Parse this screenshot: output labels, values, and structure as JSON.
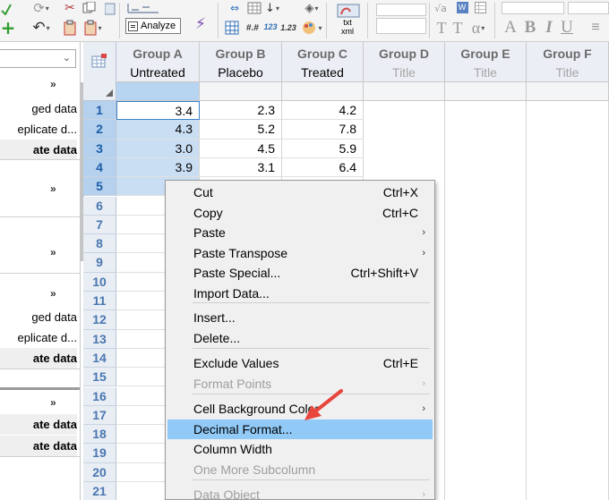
{
  "toolbar": {
    "analyze_label": "Analyze",
    "superscript_label": "123",
    "subscript_label": "1.23",
    "xml_label": "xml",
    "txt_label": "txt",
    "text_glyphs": {
      "t": "T",
      "t2": "T",
      "alpha": "α",
      "a": "A",
      "b": "B",
      "i": "I",
      "u": "U"
    },
    "icons": [
      "undo-icon",
      "redo-icon",
      "cut-icon",
      "copy-icon",
      "paste-icon",
      "new-table-icon",
      "analyze-icon",
      "sort-icon",
      "export-icon",
      "font-color-icon"
    ]
  },
  "navigator": {
    "combo_value": "",
    "sections": [
      {
        "chevron": "»",
        "items": [
          {
            "label": "ged data",
            "bold": false
          },
          {
            "label": "eplicate d...",
            "bold": false
          },
          {
            "label": "ate data",
            "bold": true
          }
        ]
      },
      {
        "chevron": "»",
        "items": []
      },
      {
        "chevron": "»",
        "items": []
      },
      {
        "chevron": "»",
        "items": [
          {
            "label": "ged data",
            "bold": false
          },
          {
            "label": "eplicate d...",
            "bold": false
          },
          {
            "label": "ate data",
            "bold": true
          }
        ]
      },
      {
        "chevron": "»",
        "items": [
          {
            "label": "ate data",
            "bold": true
          },
          {
            "label": "ate data",
            "bold": true
          }
        ]
      }
    ]
  },
  "grid": {
    "columns": [
      {
        "group": "Group A",
        "title": "Untreated",
        "placeholder": false
      },
      {
        "group": "Group B",
        "title": "Placebo",
        "placeholder": false
      },
      {
        "group": "Group C",
        "title": "Treated",
        "placeholder": false
      },
      {
        "group": "Group D",
        "title": "Title",
        "placeholder": true
      },
      {
        "group": "Group E",
        "title": "Title",
        "placeholder": true
      },
      {
        "group": "Group F",
        "title": "Title",
        "placeholder": true
      }
    ],
    "rows": [
      {
        "n": "1",
        "values": [
          "3.4",
          "2.3",
          "4.2"
        ]
      },
      {
        "n": "2",
        "values": [
          "4.3",
          "5.2",
          "7.8"
        ]
      },
      {
        "n": "3",
        "values": [
          "3.0",
          "4.5",
          "5.9"
        ]
      },
      {
        "n": "4",
        "values": [
          "3.9",
          "3.1",
          "6.4"
        ]
      },
      {
        "n": "5",
        "values": [
          "",
          "",
          ""
        ]
      },
      {
        "n": "6",
        "values": [
          "",
          "",
          ""
        ]
      },
      {
        "n": "7",
        "values": [
          "",
          "",
          ""
        ]
      },
      {
        "n": "8",
        "values": [
          "",
          "",
          ""
        ]
      },
      {
        "n": "9",
        "values": [
          "",
          "",
          ""
        ]
      },
      {
        "n": "10",
        "values": [
          "",
          "",
          ""
        ]
      },
      {
        "n": "11",
        "values": [
          "",
          "",
          ""
        ]
      },
      {
        "n": "12",
        "values": [
          "",
          "",
          ""
        ]
      },
      {
        "n": "13",
        "values": [
          "",
          "",
          ""
        ]
      },
      {
        "n": "14",
        "values": [
          "",
          "",
          ""
        ]
      },
      {
        "n": "15",
        "values": [
          "",
          "",
          ""
        ]
      },
      {
        "n": "16",
        "values": [
          "",
          "",
          ""
        ]
      },
      {
        "n": "17",
        "values": [
          "",
          "",
          ""
        ]
      },
      {
        "n": "18",
        "values": [
          "",
          "",
          ""
        ]
      },
      {
        "n": "19",
        "values": [
          "",
          "",
          ""
        ]
      },
      {
        "n": "20",
        "values": [
          "",
          "",
          ""
        ]
      },
      {
        "n": "21",
        "values": [
          "",
          "",
          ""
        ]
      }
    ],
    "selected_rows": [
      "1",
      "2",
      "3",
      "4",
      "5"
    ],
    "selection_color": "#c9def3"
  },
  "context_menu": {
    "items": [
      {
        "label": "Cut",
        "shortcut": "Ctrl+X",
        "submenu": false,
        "disabled": false,
        "highlighted": false
      },
      {
        "label": "Copy",
        "shortcut": "Ctrl+C",
        "submenu": false,
        "disabled": false,
        "highlighted": false
      },
      {
        "label": "Paste",
        "shortcut": "",
        "submenu": true,
        "disabled": false,
        "highlighted": false
      },
      {
        "label": "Paste Transpose",
        "shortcut": "",
        "submenu": true,
        "disabled": false,
        "highlighted": false
      },
      {
        "label": "Paste Special...",
        "shortcut": "Ctrl+Shift+V",
        "submenu": false,
        "disabled": false,
        "highlighted": false
      },
      {
        "label": "Import Data...",
        "shortcut": "",
        "submenu": false,
        "disabled": false,
        "highlighted": false
      },
      {
        "label": "Insert...",
        "shortcut": "",
        "submenu": false,
        "disabled": false,
        "highlighted": false
      },
      {
        "label": "Delete...",
        "shortcut": "",
        "submenu": false,
        "disabled": false,
        "highlighted": false
      },
      {
        "label": "Exclude Values",
        "shortcut": "Ctrl+E",
        "submenu": false,
        "disabled": false,
        "highlighted": false
      },
      {
        "label": "Format Points",
        "shortcut": "",
        "submenu": true,
        "disabled": true,
        "highlighted": false
      },
      {
        "label": "Cell Background Color",
        "shortcut": "",
        "submenu": true,
        "disabled": false,
        "highlighted": false
      },
      {
        "label": "Decimal Format...",
        "shortcut": "",
        "submenu": false,
        "disabled": false,
        "highlighted": true
      },
      {
        "label": "Column Width",
        "shortcut": "",
        "submenu": false,
        "disabled": false,
        "highlighted": false
      },
      {
        "label": "One More Subcolumn",
        "shortcut": "",
        "submenu": false,
        "disabled": true,
        "highlighted": false
      },
      {
        "label": "Data Object",
        "shortcut": "",
        "submenu": true,
        "disabled": true,
        "highlighted": false
      }
    ],
    "highlight_color": "#91c9f7",
    "pointer_color": "#e8453c"
  }
}
